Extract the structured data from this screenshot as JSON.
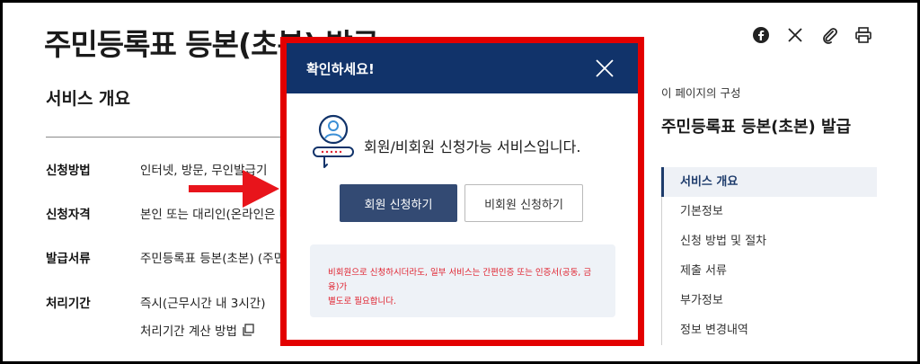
{
  "page": {
    "title": "주민등록표 등본(초본) 발급"
  },
  "share_icons": [
    "facebook-icon",
    "x-icon",
    "link-icon",
    "print-icon"
  ],
  "overview": {
    "section_title": "서비스 개요",
    "rows": [
      {
        "label": "신청방법",
        "value": "인터넷, 방문, 무인발급기"
      },
      {
        "label": "신청자격",
        "value": "본인 또는 대리인(온라인은 대"
      },
      {
        "label": "발급서류",
        "value": "주민등록표 등본(초본) (주민등"
      },
      {
        "label": "처리기간",
        "value": "즉시(근무시간 내 3시간)"
      }
    ],
    "calc_link": "처리기간 계산 방법"
  },
  "toc": {
    "caption": "이 페이지의 구성",
    "title": "주민등록표 등본(초본) 발급",
    "items": [
      {
        "label": "서비스 개요",
        "active": true
      },
      {
        "label": "기본정보",
        "active": false
      },
      {
        "label": "신청 방법 및 절차",
        "active": false
      },
      {
        "label": "제출 서류",
        "active": false
      },
      {
        "label": "부가정보",
        "active": false
      },
      {
        "label": "정보 변경내역",
        "active": false
      }
    ]
  },
  "modal": {
    "title": "확인하세요!",
    "message": "회원/비회원 신청가능 서비스입니다.",
    "member_button": "회원 신청하기",
    "guest_button": "비회원 신청하기",
    "notice_line1": "비회원으로 신청하시더라도, 일부 서비스는 간편인증 또는 인증서(공동, 금융)가",
    "notice_line2": "별도로 필요합니다."
  },
  "colors": {
    "highlight_frame": "#e30000",
    "modal_header": "#11336a",
    "primary_button": "#334a73",
    "notice_text": "#e0212e",
    "arrow": "#e8141b"
  }
}
